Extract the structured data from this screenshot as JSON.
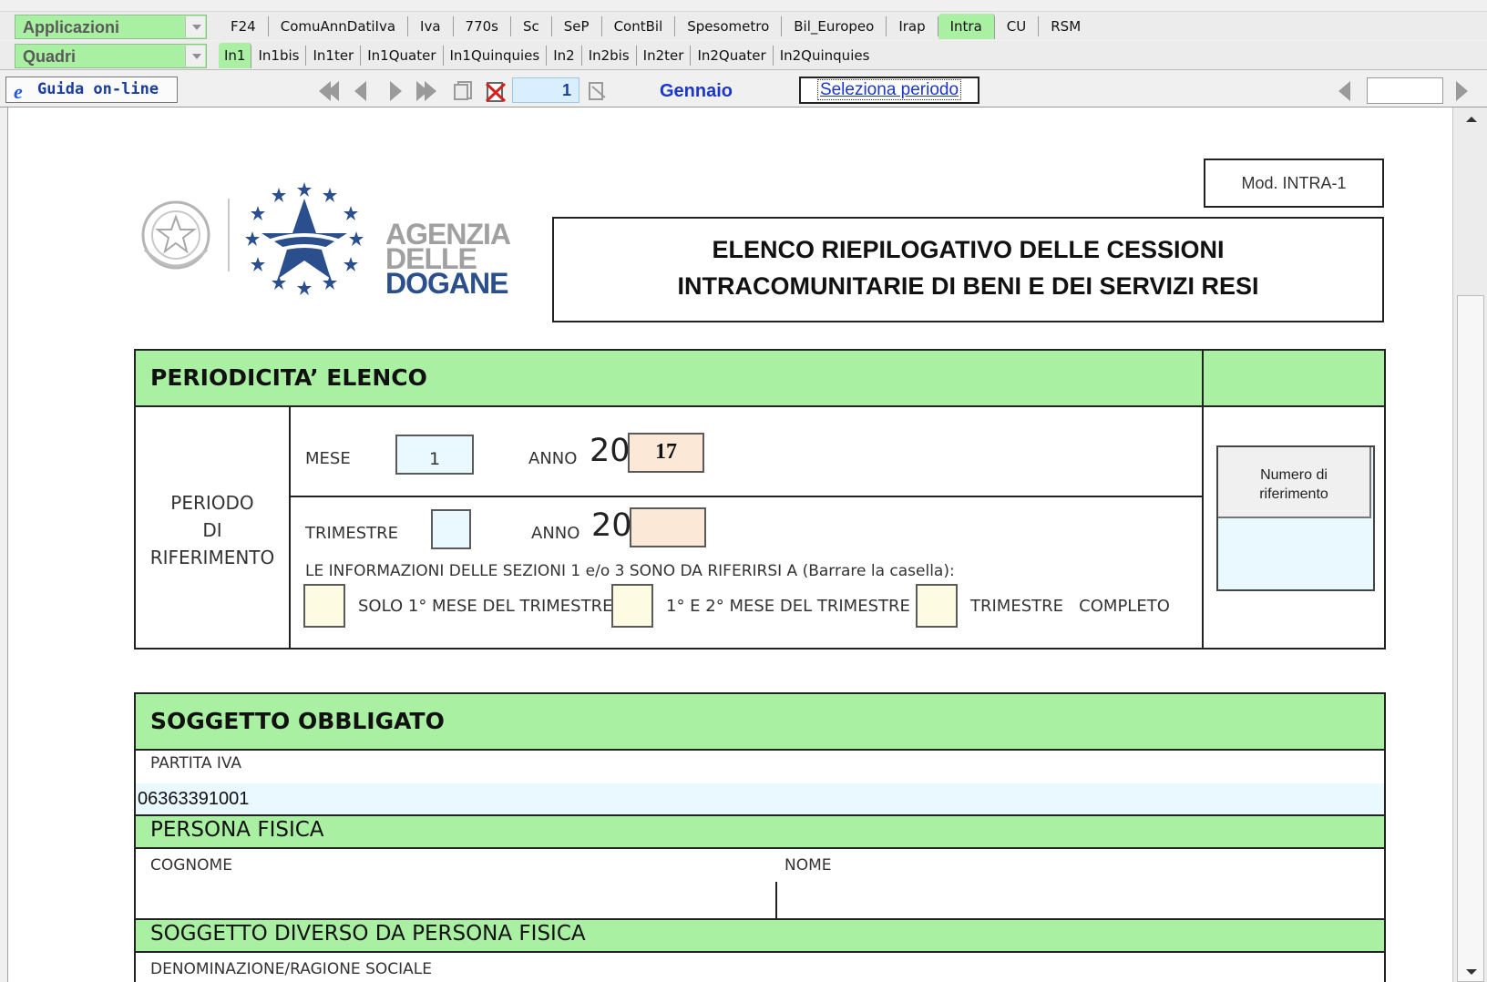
{
  "toolbar": {
    "applicazioni_label": "Applicazioni",
    "quadri_label": "Quadri",
    "app_tabs": [
      "F24",
      "ComuAnnDatiIva",
      "Iva",
      "770s",
      "Sc",
      "SeP",
      "ContBil",
      "Spesometro",
      "Bil_Europeo",
      "Irap",
      "Intra",
      "CU",
      "RSM"
    ],
    "active_app_tab": "Intra",
    "quadri_tabs": [
      "In1",
      "In1bis",
      "In1ter",
      "In1Quater",
      "In1Quinquies",
      "In2",
      "In2bis",
      "In2ter",
      "In2Quater",
      "In2Quinquies"
    ],
    "active_quadri_tab": "In1",
    "guida_label": "Guida on-line",
    "page_number": "1",
    "month": "Gennaio",
    "select_period_label": "Seleziona periodo"
  },
  "form": {
    "mod_label": "Mod. INTRA-1",
    "logo_text": [
      "AGENZIA",
      "DELLE",
      "DOGANE"
    ],
    "title_line1": "ELENCO RIEPILOGATIVO DELLE CESSIONI",
    "title_line2": "INTRACOMUNITARIE DI BENI E DEI SERVIZI RESI",
    "periodicita": {
      "title": "PERIODICITA’ ELENCO",
      "periodo_label": [
        "PERIODO",
        "DI",
        "RIFERIMENTO"
      ],
      "mese_label": "MESE",
      "mese_value": "1",
      "anno_label": "ANNO",
      "anno_prefix": "20",
      "anno_value": "17",
      "trimestre_label": "TRIMESTRE",
      "trimestre_value": "",
      "anno2_prefix": "20",
      "anno2_value": "",
      "info_text": "LE INFORMAZIONI DELLE SEZIONI 1 e/o 3 SONO DA RIFERIRSI A (Barrare la casella):",
      "option1": "SOLO 1° MESE DEL TRIMESTRE",
      "option2": "1° E 2° MESE DEL TRIMESTRE",
      "option3": "TRIMESTRE   COMPLETO",
      "numero_riferimento_button": "Numero di riferimento"
    },
    "soggetto": {
      "title": "SOGGETTO OBBLIGATO",
      "partita_iva_label": "PARTITA IVA",
      "partita_iva_value": "06363391001",
      "persona_fisica_title": "PERSONA FISICA",
      "cognome_label": "COGNOME",
      "nome_label": "NOME",
      "diverso_title": "SOGGETTO DIVERSO DA PERSONA FISICA",
      "denominazione_label": "DENOMINAZIONE/RAGIONE SOCIALE"
    }
  },
  "colors": {
    "green": "#a9f0a2",
    "light_blue": "#eaf8ff",
    "peach": "#fce8d6",
    "cream": "#fdfbe2",
    "link_blue": "#1c37c8",
    "logo_blue": "#2a4f8c"
  }
}
